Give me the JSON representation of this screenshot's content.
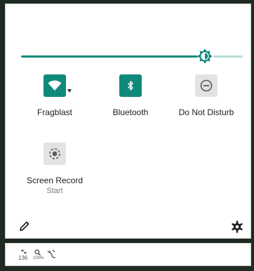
{
  "quick_settings": {
    "brightness": {
      "level": 0.83
    },
    "tiles": [
      {
        "label": "Fragblast",
        "icon": "wifi-icon",
        "state": "on",
        "has_dropdown": true
      },
      {
        "label": "Bluetooth",
        "icon": "bluetooth-icon",
        "state": "on"
      },
      {
        "label": "Do Not Disturb",
        "icon": "do-not-disturb-icon",
        "state": "off"
      },
      {
        "label": "Screen Record",
        "sublabel": "Start",
        "icon": "screen-record-icon",
        "state": "off"
      }
    ],
    "footer": {
      "edit_icon": "pencil-icon",
      "settings_icon": "gear-icon"
    }
  },
  "status_bar": {
    "network_speed": "136",
    "zoom": "100%",
    "icons": [
      "data-arrows-icon",
      "magnifier-icon",
      "unplugged-icon"
    ]
  },
  "colors": {
    "accent": "#0f8a7a",
    "accent_track": "#b6dcd6",
    "tile_off": "#e3e3e3",
    "text": "#202020",
    "subtext": "#7a7a7a"
  }
}
